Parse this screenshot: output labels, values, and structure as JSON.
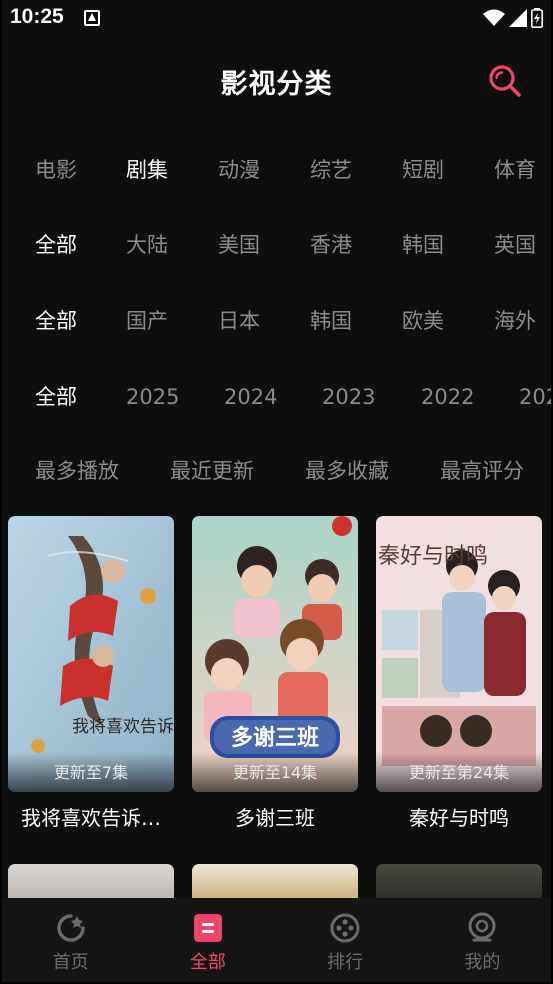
{
  "status_bar": {
    "time": "10:25"
  },
  "header": {
    "title": "影视分类"
  },
  "filters": {
    "type": [
      "电影",
      "剧集",
      "动漫",
      "综艺",
      "短剧",
      "体育"
    ],
    "region": [
      "全部",
      "大陆",
      "美国",
      "香港",
      "韩国",
      "英国"
    ],
    "sub_region": [
      "全部",
      "国产",
      "日本",
      "韩国",
      "欧美",
      "海外"
    ],
    "year": [
      "全部",
      "2025",
      "2024",
      "2023",
      "2022",
      "202"
    ],
    "sort": [
      "最多播放",
      "最近更新",
      "最多收藏",
      "最高评分"
    ]
  },
  "videos": [
    {
      "title": "我将喜欢告诉…",
      "badge": "更新至7集",
      "poster_caption": "我将喜欢告诉了风"
    },
    {
      "title": "多谢三班",
      "badge": "更新至14集",
      "poster_caption": "多谢三班"
    },
    {
      "title": "秦好与时鸣",
      "badge": "更新至第24集",
      "poster_caption": "秦好与时鸣"
    }
  ],
  "tabs": [
    {
      "label": "首页",
      "icon": "home-icon"
    },
    {
      "label": "全部",
      "icon": "category-icon"
    },
    {
      "label": "排行",
      "icon": "ranking-icon"
    },
    {
      "label": "我的",
      "icon": "profile-icon"
    }
  ],
  "colors": {
    "accent": "#f04868",
    "background": "#0e0e0e",
    "inactive": "#8b8b8b"
  }
}
